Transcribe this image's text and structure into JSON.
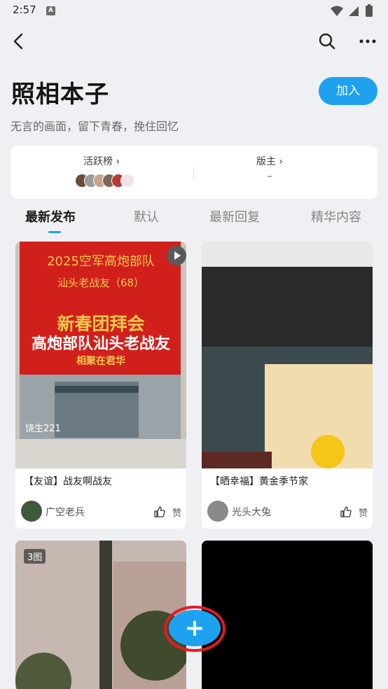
{
  "status_bar": {
    "time": "2:57",
    "a_badge": "A"
  },
  "header": {
    "back_icon": "back-arrow-icon",
    "search_icon": "search-icon",
    "more_icon": "more-dots-icon"
  },
  "forum": {
    "title": "照相本子",
    "join_label": "加入",
    "description": "无言的画面，留下青春，挽住回忆"
  },
  "stats": {
    "active_rank_label": "活跃榜 ›",
    "moderator_label": "版主 ›",
    "moderator_value": "–"
  },
  "tabs": [
    {
      "label": "最新发布",
      "active": true
    },
    {
      "label": "默认",
      "active": false
    },
    {
      "label": "最新回复",
      "active": false
    },
    {
      "label": "精华内容",
      "active": false
    }
  ],
  "posts": [
    {
      "title": "【友谊】战友啊战友",
      "author": "广空老兵",
      "like_label": "赞",
      "media": {
        "type": "video",
        "line1": "2025空军高炮部队",
        "line2": "汕头老战友（68）",
        "line3": "新春团拜会",
        "line4": "高炮部队汕头老战友",
        "line5": "相聚在君华",
        "watermark": "饶生221"
      }
    },
    {
      "title": "【晒幸福】黄金季节家",
      "author": "光头大兔",
      "like_label": "赞",
      "media": {
        "type": "image"
      }
    },
    {
      "media": {
        "type": "image",
        "count_badge": "3图"
      }
    },
    {
      "media": {
        "type": "image"
      }
    }
  ],
  "fab": {
    "label": "+"
  },
  "colors": {
    "accent": "#1ea2f0",
    "highlight_ring": "#e31b23",
    "background": "#eff0f3"
  }
}
